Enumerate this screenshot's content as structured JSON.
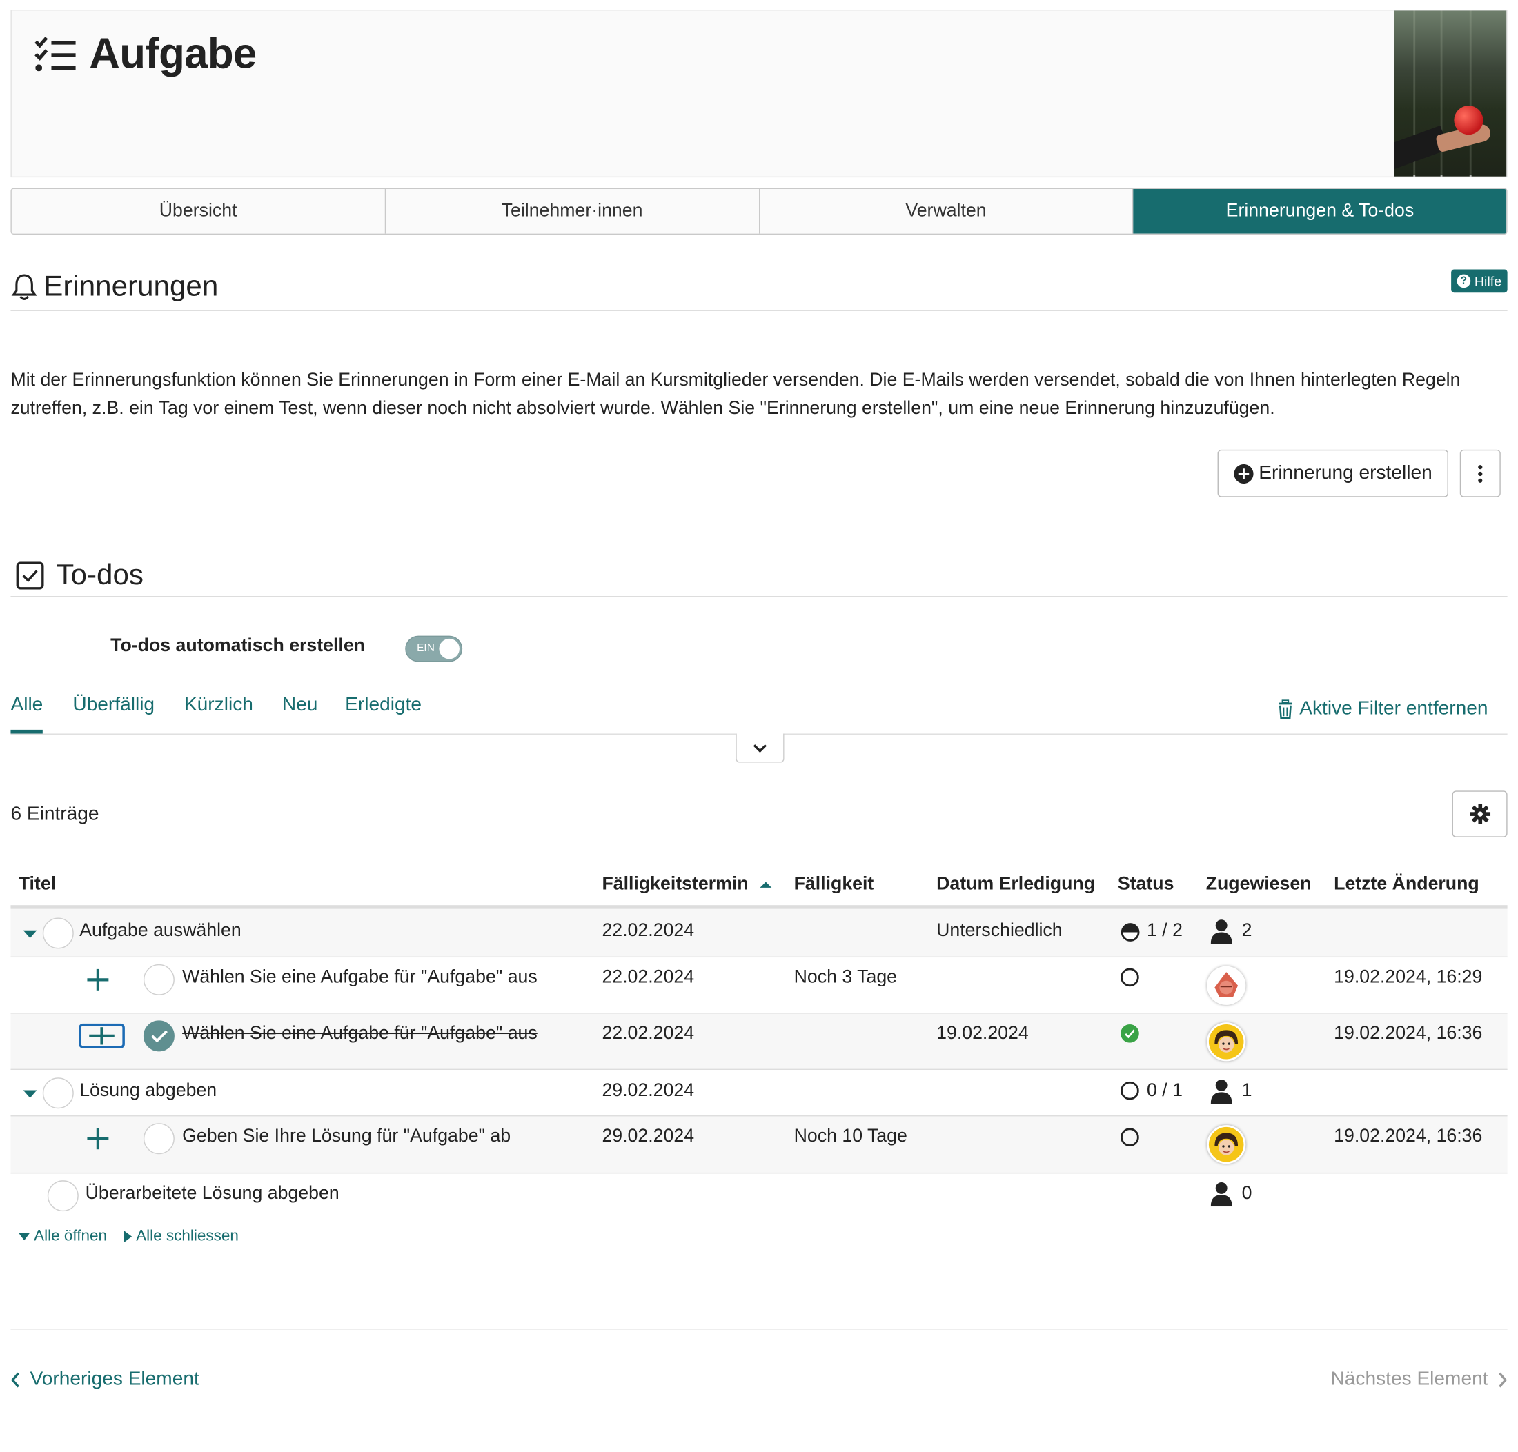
{
  "header": {
    "title": "Aufgabe"
  },
  "tabs": [
    "Übersicht",
    "Teilnehmer·innen",
    "Verwalten",
    "Erinnerungen & To-dos"
  ],
  "reminders": {
    "title": "Erinnerungen",
    "help_label": "Hilfe",
    "description": "Mit der Erinnerungsfunktion können Sie Erinnerungen in Form einer E-Mail an Kursmitglieder versenden. Die E-Mails werden versendet, sobald die von Ihnen hinterlegten Regeln zutreffen, z.B. ein Tag vor einem Test, wenn dieser noch nicht absolviert wurde. Wählen Sie \"Erinnerung erstellen\", um eine neue Erinnerung hinzuzufügen.",
    "create_label": "Erinnerung erstellen"
  },
  "todos": {
    "title": "To-dos",
    "auto_label": "To-dos automatisch erstellen",
    "toggle_label": "EIN",
    "filters": [
      "Alle",
      "Überfällig",
      "Kürzlich",
      "Neu",
      "Erledigte"
    ],
    "clear_filters": "Aktive Filter entfernen",
    "count": "6 Einträge",
    "columns": [
      "Titel",
      "Fälligkeitstermin",
      "Fälligkeit",
      "Datum Erledigung",
      "Status",
      "Zugewiesen",
      "Letzte Änderung"
    ],
    "rows": [
      {
        "title": "Aufgabe auswählen",
        "due": "22.02.2024",
        "dueIn": "",
        "done": "Unterschiedlich",
        "status": "1 / 2",
        "assigned": "2",
        "changed": ""
      },
      {
        "title": "Wählen Sie eine Aufgabe für \"Aufgabe\" aus",
        "due": "22.02.2024",
        "dueIn": "Noch 3 Tage",
        "done": "",
        "status": "",
        "assigned": "",
        "changed": "19.02.2024, 16:29"
      },
      {
        "title": "Wählen Sie eine Aufgabe für \"Aufgabe\" aus",
        "due": "22.02.2024",
        "dueIn": "",
        "done": "19.02.2024",
        "status": "",
        "assigned": "",
        "changed": "19.02.2024, 16:36"
      },
      {
        "title": "Lösung abgeben",
        "due": "29.02.2024",
        "dueIn": "",
        "done": "",
        "status": "0 / 1",
        "assigned": "1",
        "changed": ""
      },
      {
        "title": "Geben Sie Ihre Lösung für \"Aufgabe\" ab",
        "due": "29.02.2024",
        "dueIn": "Noch 10 Tage",
        "done": "",
        "status": "",
        "assigned": "",
        "changed": "19.02.2024, 16:36"
      },
      {
        "title": "Überarbeitete Lösung abgeben",
        "due": "",
        "dueIn": "",
        "done": "",
        "status": "",
        "assigned": "0",
        "changed": ""
      }
    ],
    "open_all": "Alle öffnen",
    "close_all": "Alle schliessen"
  },
  "footer": {
    "prev": "Vorheriges Element",
    "next": "Nächstes Element"
  },
  "colors": {
    "accent": "#176c6e",
    "status_done": "#3aa346"
  }
}
